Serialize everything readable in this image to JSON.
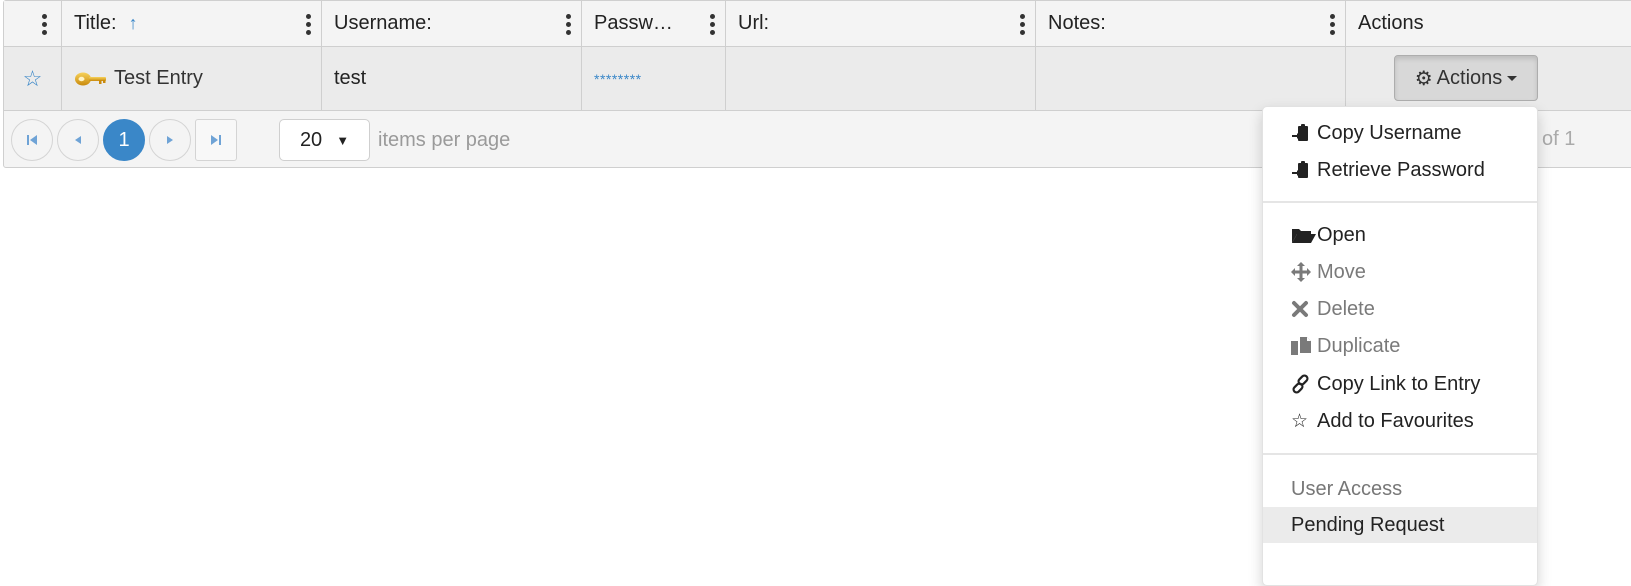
{
  "grid": {
    "columns": [
      {
        "label": ""
      },
      {
        "label": "Title:",
        "sort": "ascending"
      },
      {
        "label": "Username:"
      },
      {
        "label": "Passw…"
      },
      {
        "label": "Url:"
      },
      {
        "label": "Notes:"
      },
      {
        "label": "Actions"
      }
    ],
    "rows": [
      {
        "favourite_icon": "star-outline-icon",
        "title_icon": "key-icon",
        "title": "Test Entry",
        "username": "test",
        "password": "********",
        "url": "",
        "notes": "",
        "actions_label": "Actions"
      }
    ],
    "icons": {
      "gear": "⚙",
      "star": "☆",
      "sort_up": "↑"
    }
  },
  "pager": {
    "first": "first-page-icon",
    "prev": "prev-page-icon",
    "current_page": "1",
    "next": "next-page-icon",
    "last": "last-page-icon",
    "page_size": "20",
    "items_per_page_label": "items per page",
    "info": "of 1"
  },
  "menu": {
    "group1": [
      {
        "label": "Copy Username",
        "icon": "clipboard-icon",
        "disabled": false
      },
      {
        "label": "Retrieve Password",
        "icon": "clipboard-icon",
        "disabled": false
      }
    ],
    "group2": [
      {
        "label": "Open",
        "icon": "folder-open-icon",
        "disabled": false
      },
      {
        "label": "Move",
        "icon": "move-icon",
        "disabled": true
      },
      {
        "label": "Delete",
        "icon": "delete-icon",
        "disabled": true
      },
      {
        "label": "Duplicate",
        "icon": "duplicate-icon",
        "disabled": true
      },
      {
        "label": "Copy Link to Entry",
        "icon": "link-icon",
        "disabled": false
      },
      {
        "label": "Add to Favourites",
        "icon": "star-icon",
        "disabled": false
      }
    ],
    "section_header": "User Access",
    "group3": [
      {
        "label": "Pending Request",
        "highlighted": true
      }
    ]
  },
  "colors": {
    "accent": "#3a87c8",
    "key_gold": "#e0a81e"
  }
}
